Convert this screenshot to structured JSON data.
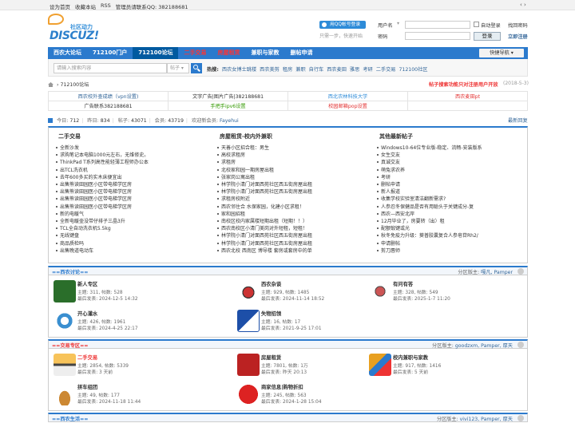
{
  "topbar": {
    "links": [
      "设为首页",
      "收藏本站",
      "RSS",
      "管理员请联系QQ: 382188681"
    ],
    "arrows": "‹ ›"
  },
  "header": {
    "logo_cn": "社区动力",
    "logo_en": "DISCUZ!",
    "qq_login": "用QQ帐号登录",
    "qq_tip": "只需一步，快速开始",
    "username_label": "用户名",
    "password_label": "密码",
    "remember_label": "自动登录",
    "forgot_label": "找回密码",
    "login_button": "登录",
    "register_label": "立即注册"
  },
  "nav": {
    "items": [
      {
        "label": "西农大论坛",
        "style": "normal"
      },
      {
        "label": "712100门户",
        "style": "normal"
      },
      {
        "label": "712100论坛",
        "style": "active"
      },
      {
        "label": "二手交易",
        "style": "red"
      },
      {
        "label": "房屋租赁",
        "style": "red"
      },
      {
        "label": "兼职与家教",
        "style": "normal"
      },
      {
        "label": "删帖申请",
        "style": "normal"
      }
    ],
    "quick": "快捷导航 ▾"
  },
  "search": {
    "placeholder": "请输入搜索内容",
    "type": "帖子 ▾",
    "hot_label": "热搜:",
    "hot": [
      "西农女博士跳楼",
      "西农美剪",
      "租房",
      "兼职",
      "自行车",
      "西农麦田",
      "雅思",
      "考研",
      "二手交易",
      "712100社区"
    ]
  },
  "crumb": {
    "separator": "›",
    "current": "712100论坛",
    "notice": "帖子搜索功能只对注册用户开放",
    "notice_date": "(2018-5-3)"
  },
  "ads": [
    [
      {
        "text": "西农校外查成绩（vpn设置)",
        "color": "#336699"
      },
      {
        "text": "文字广告|图片广告|382188681",
        "color": "#333333"
      },
      {
        "text": "西北农林科技大学",
        "color": "#2d8bd8"
      },
      {
        "text": "西农麦田pt",
        "color": "#e33333"
      }
    ],
    [
      {
        "text": "广告联系382188681",
        "color": "#333333"
      },
      {
        "text": "手把手ipv6设置",
        "color": "#339900"
      },
      {
        "text": "校园邮箱pop设置",
        "color": "#e33333"
      },
      {
        "text": "",
        "color": "#333333"
      }
    ]
  ],
  "stats": {
    "today_label": "今日:",
    "today": "712",
    "yesterday_label": "昨日:",
    "yesterday": "834",
    "posts_label": "帖子:",
    "posts": "43071",
    "members_label": "会员:",
    "members": "43719",
    "newest_label": "欢迎新会员:",
    "newest": "Fayehui",
    "latest_link": "最新回复"
  },
  "threads": [
    {
      "title": "二手交易",
      "items": [
        "全新沙发",
        "求购笔记本电脑1000元左右，无维修史。",
        "ThinkPad T系列高性能轻薄工程师办公本",
        "出TCL洗衣机",
        "去年600多买的实木床便宜出",
        "出售熊读田园医小区带电梯学区房",
        "出售熊读田园医小区带电梯学区房",
        "出售熊读田园医小区带电梯学区房",
        "出售熊读田园医小区带电梯学区房",
        "新的电暖气",
        "全新电暖壶没带仔排子三晶3升",
        "TCL全自动洗衣机5.5kg",
        "无线键盘",
        "商品质检吗",
        "出售晚道电动车"
      ]
    },
    {
      "title": "房屋租赁-校内外兼职",
      "items": [
        "天善小区招合租：男生",
        "高校求租房",
        "求租房",
        "北校家和园一期房屋出租",
        "张家岗公寓出租",
        "林学院小清门对面西苑社区西五街房屋出租",
        "林学院小清门对面西苑社区西五街房屋出租",
        "求租房校附近",
        "西农邻住合 水保家园，化建小区求租！",
        "家和园招租",
        "南校区校内家属楼短期出租（短期！！）",
        "西农南校区小清门美岗对外短租，短租！",
        "林学院小清门对面西苑社区西五街房屋出租",
        "林学院小清门对面西苑社区西五街房屋出租",
        "西农北校 西南区 博导楼 套房或套房中的单"
      ]
    },
    {
      "title": "其他最新帖子",
      "items": [
        "Windows10-64位专业版-稳定、流畅-安装版系",
        "女生交友",
        "真诚交友",
        "萌兔求农养",
        "考研",
        "删帖申请",
        "新人报道",
        "收集学校实验室清洁翻新需求?",
        "人参忍冬保健品是否有用聪头于关键成分-复",
        "西农—西安北岸",
        "12月毕业了，房要转（出）租",
        "配额锻键或光",
        "秋冬免疫力升级：葵普胶囊复合人参皂苷Rh2/",
        "申请删帖",
        "剪刀唇师"
      ]
    }
  ],
  "sections": [
    {
      "title": "==西农讨论==",
      "title_color": "blue",
      "mods_label": "分区版主:",
      "mods": "嘎凡, Pamper",
      "forums": [
        {
          "name": "新人专区",
          "name_color": "normal",
          "stat": "主题: 311, 帖数: 528",
          "last": "最后发表: 2024-12-5 14:32",
          "icon": "newbie-icon"
        },
        {
          "name": "西农杂谈",
          "name_color": "normal",
          "stat": "主题: 929, 帖数: 1485",
          "last": "最后发表: 2024-11-14 18:52",
          "icon": "chat-icon"
        },
        {
          "name": "有问有答",
          "name_color": "normal",
          "stat": "主题: 328, 帖数: 549",
          "last": "最后发表: 2025-1-7 11:20",
          "icon": "qa-icon"
        },
        {
          "name": "开心灌水",
          "name_color": "normal",
          "stat": "主题: 426, 帖数: 1961",
          "last": "最后发表: 2024-4-25 22:17",
          "icon": "water-icon"
        },
        {
          "name": "失物招领",
          "name_color": "normal",
          "stat": "主题: 16, 帖数: 17",
          "last": "最后发表: 2021-9-25 17:01",
          "icon": "lost-found-icon"
        }
      ]
    },
    {
      "title": "==交易专区==",
      "title_color": "red",
      "mods_label": "分区版主:",
      "mods": "goodzxm, Pamper, 厚天",
      "forums": [
        {
          "name": "二手交易",
          "name_color": "red",
          "stat": "主题: 2854, 帖数: 5339",
          "last": "最后发表: 3 天前",
          "icon": "secondhand-icon"
        },
        {
          "name": "房屋租赁",
          "name_color": "normal",
          "stat": "主题: 7801, 帖数: 1万",
          "last": "最后发表: 昨天 20:13",
          "icon": "rent-icon"
        },
        {
          "name": "校内兼职与家教",
          "name_color": "normal",
          "stat": "主题: 917, 帖数: 1416",
          "last": "最后发表: 5 天前",
          "icon": "parttime-icon"
        },
        {
          "name": "拼车组团",
          "name_color": "normal",
          "stat": "主题: 49, 帖数: 177",
          "last": "最后发表: 2024-11-18 11:44",
          "icon": "carpool-icon"
        },
        {
          "name": "商家信息|购物折扣",
          "name_color": "normal",
          "stat": "主题: 245, 帖数: 563",
          "last": "最后发表: 2024-1-28 15:04",
          "icon": "discount-icon"
        }
      ]
    },
    {
      "title": "==西农生活==",
      "title_color": "blue",
      "mods_label": "分区版主:",
      "mods": "vivi123, Pamper, 厚天",
      "forums": []
    }
  ],
  "colors": {
    "brand": "#2b7acd",
    "nav_active": "#005aa0",
    "red": "#e33333"
  }
}
